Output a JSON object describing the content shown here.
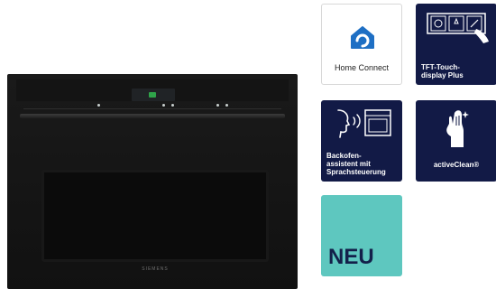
{
  "product": {
    "brand": "SIEMENS"
  },
  "badges": [
    {
      "label": "Home Connect",
      "icon": "home-connect-icon"
    },
    {
      "label": "TFT-Touch-\ndisplay Plus",
      "icon": "tft-touch-display-icon"
    },
    {
      "label": "Backofen-\nassistent mit\nSprachsteuerung",
      "icon": "voice-assistant-oven-icon"
    },
    {
      "label": "activeClean®",
      "icon": "glove-icon"
    },
    {
      "label": "NEU",
      "icon": ""
    }
  ],
  "colors": {
    "navy": "#121a46",
    "teal": "#5ec7bf",
    "home_connect_blue": "#1e6fc4",
    "oven_black": "#151515"
  }
}
